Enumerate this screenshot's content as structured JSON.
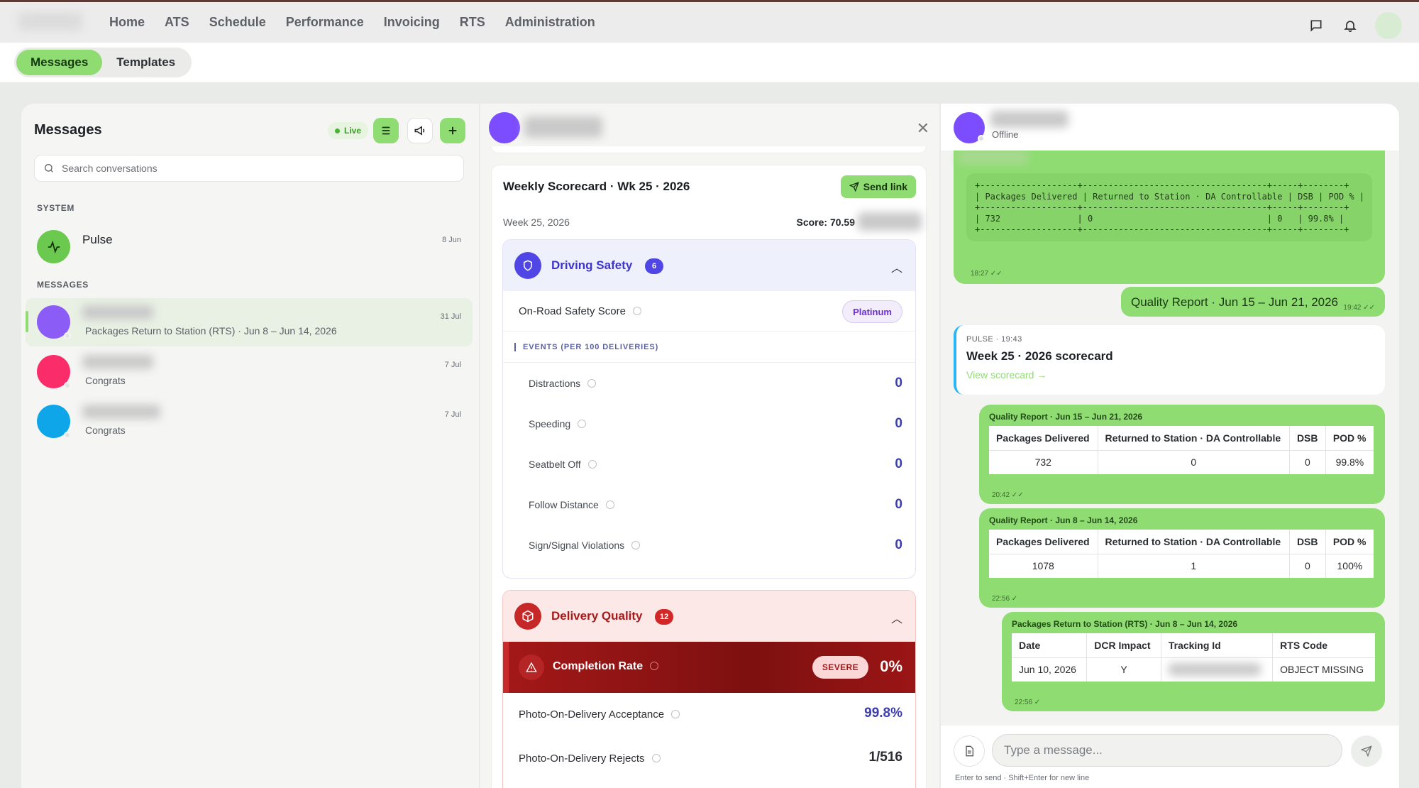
{
  "nav": {
    "items": [
      "Home",
      "ATS",
      "Schedule",
      "Performance",
      "Invoicing",
      "RTS",
      "Administration"
    ]
  },
  "subnav": {
    "tabs": [
      "Messages",
      "Templates"
    ],
    "active": "Messages"
  },
  "left": {
    "title": "Messages",
    "live_label": "Live",
    "search_placeholder": "Search conversations",
    "system_label": "SYSTEM",
    "messages_label": "MESSAGES",
    "system_conv": {
      "name": "Pulse",
      "date": "8 Jun"
    },
    "conversations": [
      {
        "preview": "Packages Return to Station (RTS) · Jun 8 – Jun 14, 2026",
        "date": "31 Jul",
        "avatar_color": "#8b5cf6"
      },
      {
        "preview": "Congrats",
        "date": "7 Jul",
        "avatar_color": "#fb2c6a"
      },
      {
        "preview": "Congrats",
        "date": "7 Jul",
        "avatar_color": "#0ea5e9"
      }
    ]
  },
  "scorecard": {
    "title": "Weekly Scorecard · Wk 25 · 2026",
    "send_label": "Send link",
    "week": "Week 25, 2026",
    "score": "Score: 70.59",
    "driving_safety": {
      "title": "Driving Safety",
      "badge": "6",
      "on_road_label": "On-Road Safety Score",
      "on_road_value": "Platinum",
      "events_label": "EVENTS (PER 100 DELIVERIES)",
      "events": [
        {
          "label": "Distractions",
          "value": "0"
        },
        {
          "label": "Speeding",
          "value": "0"
        },
        {
          "label": "Seatbelt Off",
          "value": "0"
        },
        {
          "label": "Follow Distance",
          "value": "0"
        },
        {
          "label": "Sign/Signal Violations",
          "value": "0"
        }
      ]
    },
    "delivery_quality": {
      "title": "Delivery Quality",
      "badge": "12",
      "completion_label": "Completion Rate",
      "completion_badge": "SEVERE",
      "completion_value": "0%",
      "rows": [
        {
          "label": "Photo-On-Delivery Acceptance",
          "value": "99.8%"
        },
        {
          "label": "Photo-On-Delivery Rejects",
          "value": "1/516"
        }
      ]
    }
  },
  "chat": {
    "status": "Offline",
    "mono_table": {
      "line1": "+-------------------+------------------------------------+-----+--------+",
      "line2": "| Packages Delivered | Returned to Station · DA Controllable | DSB | POD % |",
      "line3": "+-------------------+------------------------------------+-----+--------+",
      "line4": "| 732               | 0                                  | 0   | 99.8% |",
      "line5": "+-------------------+------------------------------------+-----+--------+",
      "time": "18:27"
    },
    "quality_link": {
      "text": "Quality Report · Jun 15 – Jun 21, 2026",
      "time": "19:42"
    },
    "pulse_card": {
      "sender": "PULSE",
      "time": "19:43",
      "title": "Week 25 · 2026 scorecard",
      "link": "View scorecard →"
    },
    "report1": {
      "title": "Quality Report · Jun 15 – Jun 21, 2026",
      "headers": [
        "Packages Delivered",
        "Returned to Station · DA Controllable",
        "DSB",
        "POD %"
      ],
      "row": [
        "732",
        "0",
        "0",
        "99.8%"
      ],
      "time": "20:42"
    },
    "report2": {
      "title": "Quality Report · Jun 8 – Jun 14, 2026",
      "headers": [
        "Packages Delivered",
        "Returned to Station · DA Controllable",
        "DSB",
        "POD %"
      ],
      "row": [
        "1078",
        "1",
        "0",
        "100%"
      ],
      "time": "22:56"
    },
    "report3": {
      "title": "Packages Return to Station (RTS) · Jun 8 – Jun 14, 2026",
      "headers": [
        "Date",
        "DCR Impact",
        "Tracking Id",
        "RTS Code"
      ],
      "row": [
        "Jun 10, 2026",
        "Y",
        "",
        "OBJECT MISSING"
      ],
      "time": "22:56"
    },
    "composer_placeholder": "Type a message...",
    "composer_hint": "Enter to send · Shift+Enter for new line"
  },
  "colors": {
    "accent": "#8fdc72",
    "purple": "#7c4dff",
    "indigo": "#4f46e5",
    "danger": "#c62828"
  }
}
